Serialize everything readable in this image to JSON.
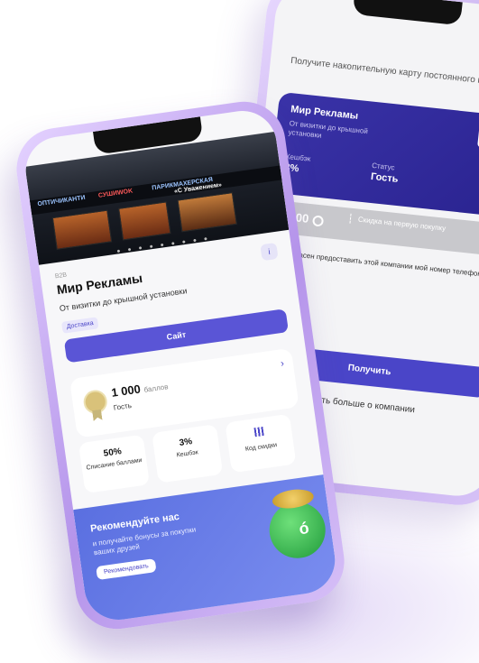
{
  "back": {
    "intro": "Получите накопительную карту постоянного клиента",
    "card_title": "Мир Рекламы",
    "card_subtitle": "От визитки до крышной установки",
    "cashback_label": "Кешбэк",
    "cashback_value": "3%",
    "status_label": "Статус",
    "status_value": "Гость",
    "points_value": "1 000",
    "points_discount": "Скидка на первую покупку",
    "consent": "Я согласен предоставить этой компании мой номер телефона",
    "get_button": "Получить",
    "more_link": "ать больше о компании"
  },
  "front": {
    "signs": [
      "ОПТИЧИКАНТИ",
      "СУШИWOK",
      "ПАРИКМАХЕРСКАЯ",
      "«С Уважением»"
    ],
    "category": "B2B",
    "title": "Мир Рекламы",
    "info_icon": "i",
    "description": "От визитки до крышной установки",
    "tag": "Доставка",
    "site_button": "Сайт",
    "balance_value": "1 000",
    "balance_unit": "баллов",
    "status": "Гость",
    "tiles": [
      {
        "value": "50%",
        "label": "Списание баллами"
      },
      {
        "value": "3%",
        "label": "Кешбэк"
      },
      {
        "value": "",
        "label": "Код скидки"
      }
    ],
    "promo_title": "Рекомендуйте нас",
    "promo_text": "и получайте бонусы за покупки ваших друзей",
    "promo_button": "Рекомендовать"
  }
}
